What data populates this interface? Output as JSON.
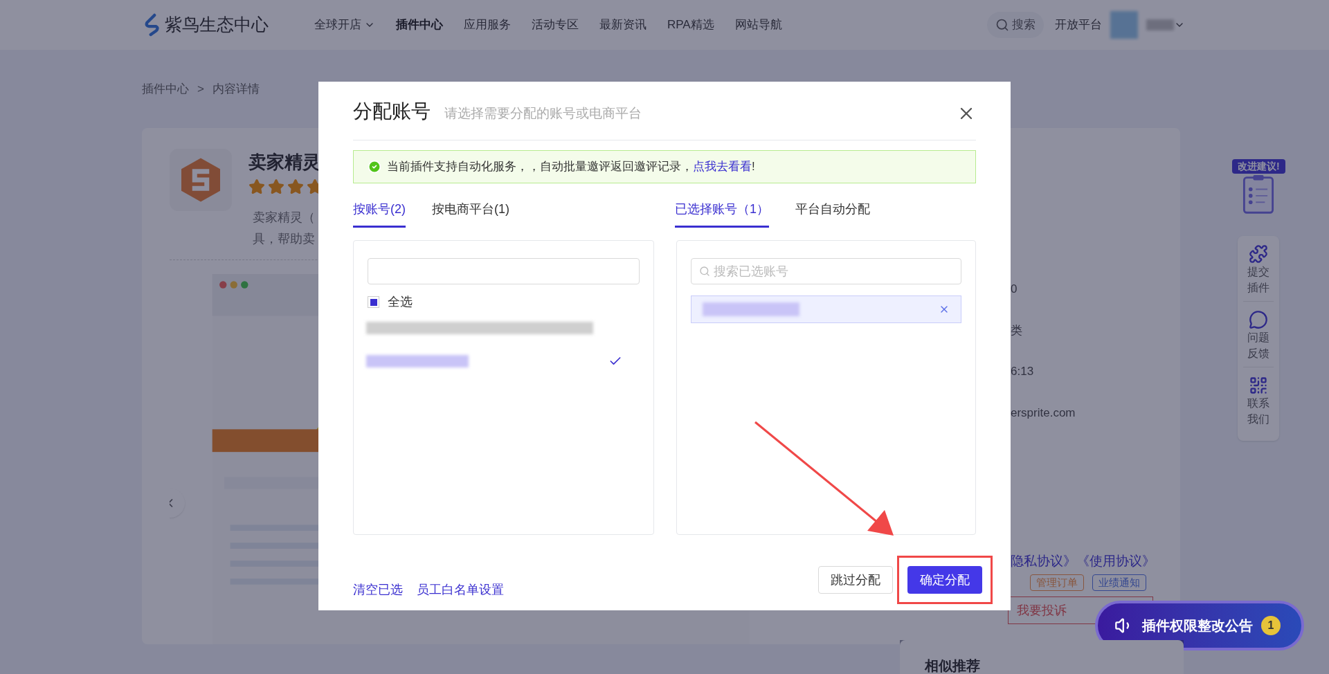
{
  "nav": {
    "brand": "紫鸟生态中心",
    "items": [
      {
        "label": "全球开店",
        "dropdown": true,
        "selected": false
      },
      {
        "label": "插件中心",
        "dropdown": false,
        "selected": true
      },
      {
        "label": "应用服务",
        "dropdown": false,
        "selected": false
      },
      {
        "label": "活动专区",
        "dropdown": false,
        "selected": false
      },
      {
        "label": "最新资讯",
        "dropdown": false,
        "selected": false
      },
      {
        "label": "RPA精选",
        "dropdown": false,
        "selected": false
      },
      {
        "label": "网站导航",
        "dropdown": false,
        "selected": false
      }
    ],
    "search": "搜索",
    "open_platform": "开放平台"
  },
  "breadcrumb": [
    "插件中心",
    ">",
    "内容详情"
  ],
  "plugin": {
    "title": "卖家精灵",
    "stars": 4,
    "description_lines": [
      "卖家精灵（",
      "具，帮助卖"
    ]
  },
  "info": {
    "fragments": [
      "0",
      "类",
      "6:13",
      "ersprite.com"
    ],
    "agreements": "隐私协议》《使用协议》",
    "tags": [
      {
        "label": "管理订单",
        "kind": "orders"
      },
      {
        "label": "业绩通知",
        "kind": "performance"
      }
    ],
    "complaint": "我要投诉"
  },
  "similar": {
    "title": "相似推荐"
  },
  "side": {
    "suggest": "改进建议!",
    "items": [
      {
        "kind": "puzzle",
        "label": "提交插件"
      },
      {
        "kind": "chat",
        "label": "问题反馈"
      },
      {
        "kind": "qr",
        "label": "联系我们"
      }
    ]
  },
  "announcement": {
    "label": "插件权限整改公告",
    "count": "1"
  },
  "modal": {
    "title": "分配账号",
    "subtitle": "请选择需要分配的账号或电商平台",
    "notice": {
      "text": "当前插件支持自动化服务，，自动批量邀评返回邀评记录，",
      "link": "点我去看看",
      "end": "!"
    },
    "left_tabs": [
      {
        "label": "按账号(2)",
        "selected": true
      },
      {
        "label": "按电商平台(1)",
        "selected": false
      }
    ],
    "right_tabs": [
      {
        "label": "已选择账号（1）",
        "selected": true
      },
      {
        "label": "平台自动分配",
        "selected": false
      }
    ],
    "select_all": {
      "label": "全选",
      "checked": true
    },
    "accounts": [
      {
        "selected": false
      },
      {
        "selected": true
      }
    ],
    "search_placeholder": "搜索已选账号",
    "footer_links": [
      "清空已选",
      "员工白名单设置"
    ],
    "skip": "跳过分配",
    "confirm": "确定分配"
  }
}
